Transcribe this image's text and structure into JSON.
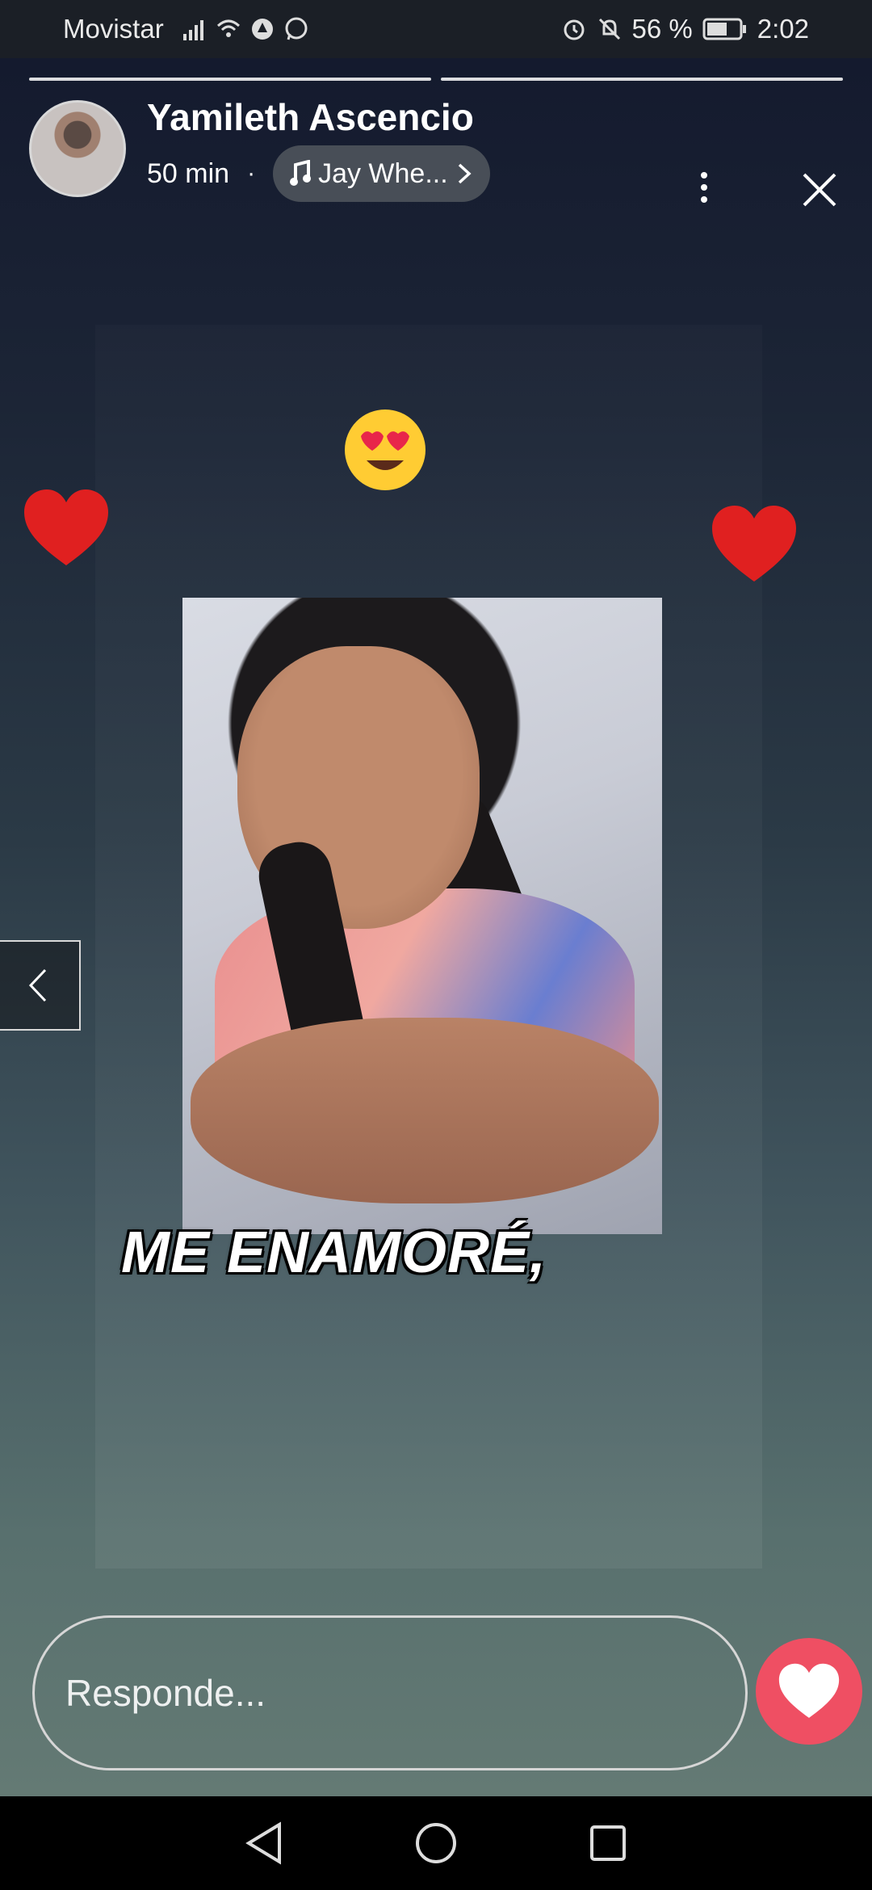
{
  "status_bar": {
    "carrier": "Movistar",
    "battery": "56 %",
    "time": "2:02",
    "icons": [
      "signal-icon",
      "wifi-icon",
      "sync-icon",
      "whatsapp-icon",
      "alarm-icon",
      "bell-off-icon",
      "battery-icon"
    ]
  },
  "story": {
    "segments": 2,
    "active_segment": 2,
    "user_name": "Yamileth Ascencio",
    "time_ago": "50 min",
    "separator": "·",
    "music": "Jay Whe...",
    "caption": "ME ENAMORÉ,",
    "stickers": [
      "heart-eyes-emoji",
      "red-heart",
      "red-heart"
    ]
  },
  "reply": {
    "placeholder": "Responde..."
  },
  "colors": {
    "like": "#ef4f63",
    "heart": "#e02020"
  },
  "nav": {
    "icons": [
      "back-icon",
      "home-icon",
      "recents-icon"
    ]
  }
}
